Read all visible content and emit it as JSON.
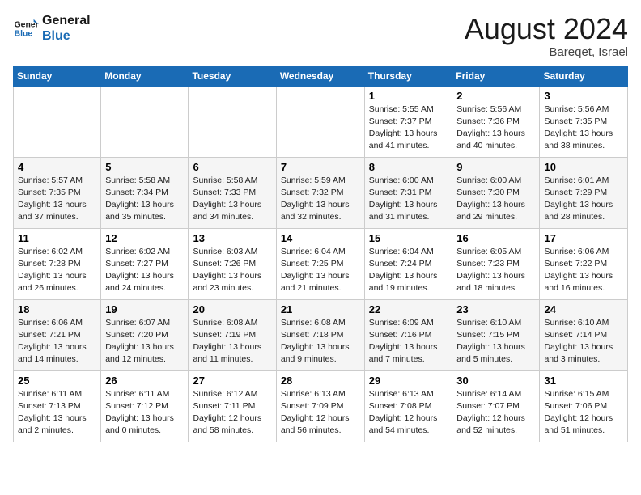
{
  "logo": {
    "line1": "General",
    "line2": "Blue"
  },
  "title": "August 2024",
  "location": "Bareqet, Israel",
  "days_of_week": [
    "Sunday",
    "Monday",
    "Tuesday",
    "Wednesday",
    "Thursday",
    "Friday",
    "Saturday"
  ],
  "weeks": [
    [
      {
        "num": "",
        "info": ""
      },
      {
        "num": "",
        "info": ""
      },
      {
        "num": "",
        "info": ""
      },
      {
        "num": "",
        "info": ""
      },
      {
        "num": "1",
        "info": "Sunrise: 5:55 AM\nSunset: 7:37 PM\nDaylight: 13 hours\nand 41 minutes."
      },
      {
        "num": "2",
        "info": "Sunrise: 5:56 AM\nSunset: 7:36 PM\nDaylight: 13 hours\nand 40 minutes."
      },
      {
        "num": "3",
        "info": "Sunrise: 5:56 AM\nSunset: 7:35 PM\nDaylight: 13 hours\nand 38 minutes."
      }
    ],
    [
      {
        "num": "4",
        "info": "Sunrise: 5:57 AM\nSunset: 7:35 PM\nDaylight: 13 hours\nand 37 minutes."
      },
      {
        "num": "5",
        "info": "Sunrise: 5:58 AM\nSunset: 7:34 PM\nDaylight: 13 hours\nand 35 minutes."
      },
      {
        "num": "6",
        "info": "Sunrise: 5:58 AM\nSunset: 7:33 PM\nDaylight: 13 hours\nand 34 minutes."
      },
      {
        "num": "7",
        "info": "Sunrise: 5:59 AM\nSunset: 7:32 PM\nDaylight: 13 hours\nand 32 minutes."
      },
      {
        "num": "8",
        "info": "Sunrise: 6:00 AM\nSunset: 7:31 PM\nDaylight: 13 hours\nand 31 minutes."
      },
      {
        "num": "9",
        "info": "Sunrise: 6:00 AM\nSunset: 7:30 PM\nDaylight: 13 hours\nand 29 minutes."
      },
      {
        "num": "10",
        "info": "Sunrise: 6:01 AM\nSunset: 7:29 PM\nDaylight: 13 hours\nand 28 minutes."
      }
    ],
    [
      {
        "num": "11",
        "info": "Sunrise: 6:02 AM\nSunset: 7:28 PM\nDaylight: 13 hours\nand 26 minutes."
      },
      {
        "num": "12",
        "info": "Sunrise: 6:02 AM\nSunset: 7:27 PM\nDaylight: 13 hours\nand 24 minutes."
      },
      {
        "num": "13",
        "info": "Sunrise: 6:03 AM\nSunset: 7:26 PM\nDaylight: 13 hours\nand 23 minutes."
      },
      {
        "num": "14",
        "info": "Sunrise: 6:04 AM\nSunset: 7:25 PM\nDaylight: 13 hours\nand 21 minutes."
      },
      {
        "num": "15",
        "info": "Sunrise: 6:04 AM\nSunset: 7:24 PM\nDaylight: 13 hours\nand 19 minutes."
      },
      {
        "num": "16",
        "info": "Sunrise: 6:05 AM\nSunset: 7:23 PM\nDaylight: 13 hours\nand 18 minutes."
      },
      {
        "num": "17",
        "info": "Sunrise: 6:06 AM\nSunset: 7:22 PM\nDaylight: 13 hours\nand 16 minutes."
      }
    ],
    [
      {
        "num": "18",
        "info": "Sunrise: 6:06 AM\nSunset: 7:21 PM\nDaylight: 13 hours\nand 14 minutes."
      },
      {
        "num": "19",
        "info": "Sunrise: 6:07 AM\nSunset: 7:20 PM\nDaylight: 13 hours\nand 12 minutes."
      },
      {
        "num": "20",
        "info": "Sunrise: 6:08 AM\nSunset: 7:19 PM\nDaylight: 13 hours\nand 11 minutes."
      },
      {
        "num": "21",
        "info": "Sunrise: 6:08 AM\nSunset: 7:18 PM\nDaylight: 13 hours\nand 9 minutes."
      },
      {
        "num": "22",
        "info": "Sunrise: 6:09 AM\nSunset: 7:16 PM\nDaylight: 13 hours\nand 7 minutes."
      },
      {
        "num": "23",
        "info": "Sunrise: 6:10 AM\nSunset: 7:15 PM\nDaylight: 13 hours\nand 5 minutes."
      },
      {
        "num": "24",
        "info": "Sunrise: 6:10 AM\nSunset: 7:14 PM\nDaylight: 13 hours\nand 3 minutes."
      }
    ],
    [
      {
        "num": "25",
        "info": "Sunrise: 6:11 AM\nSunset: 7:13 PM\nDaylight: 13 hours\nand 2 minutes."
      },
      {
        "num": "26",
        "info": "Sunrise: 6:11 AM\nSunset: 7:12 PM\nDaylight: 13 hours\nand 0 minutes."
      },
      {
        "num": "27",
        "info": "Sunrise: 6:12 AM\nSunset: 7:11 PM\nDaylight: 12 hours\nand 58 minutes."
      },
      {
        "num": "28",
        "info": "Sunrise: 6:13 AM\nSunset: 7:09 PM\nDaylight: 12 hours\nand 56 minutes."
      },
      {
        "num": "29",
        "info": "Sunrise: 6:13 AM\nSunset: 7:08 PM\nDaylight: 12 hours\nand 54 minutes."
      },
      {
        "num": "30",
        "info": "Sunrise: 6:14 AM\nSunset: 7:07 PM\nDaylight: 12 hours\nand 52 minutes."
      },
      {
        "num": "31",
        "info": "Sunrise: 6:15 AM\nSunset: 7:06 PM\nDaylight: 12 hours\nand 51 minutes."
      }
    ]
  ]
}
